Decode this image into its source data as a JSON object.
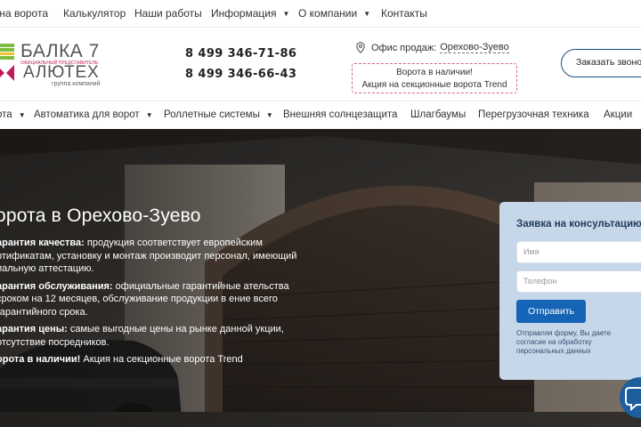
{
  "topnav": {
    "items": [
      {
        "label": " на ворота",
        "dropdown": false
      },
      {
        "label": "Калькулятор",
        "dropdown": false
      },
      {
        "label": "Наши работы",
        "dropdown": false
      },
      {
        "label": "Информация",
        "dropdown": true
      },
      {
        "label": "О компании",
        "dropdown": true
      },
      {
        "label": "Контакты",
        "dropdown": false
      }
    ]
  },
  "header": {
    "logo": {
      "line1": "БАЛКА 7",
      "small": "ОФИЦИАЛЬНЫЙ ПРЕДСТАВИТЕЛЬ",
      "line2": "АЛЮТЕХ",
      "group": "группа компаний",
      "colors": {
        "green": "#7bbd3c",
        "yellow": "#f2c12e",
        "magenta": "#c2185b"
      }
    },
    "phones": [
      "8 499 346-71-86",
      "8 499 346-66-43"
    ],
    "office": {
      "label": "Офис продаж:",
      "city": "Орехово-Зуево",
      "icon": "location-pin-icon"
    },
    "promo": {
      "line1": "Ворота в наличии!",
      "line2": "Акция на секционные ворота Trend"
    },
    "callback_label": "Заказать звонок"
  },
  "catnav": {
    "items": [
      {
        "label": "ота",
        "dropdown": true
      },
      {
        "label": "Автоматика для ворот",
        "dropdown": true
      },
      {
        "label": "Роллетные системы",
        "dropdown": true
      },
      {
        "label": "Внешняя солнцезащита",
        "dropdown": false
      },
      {
        "label": "Шлагбаумы",
        "dropdown": false
      },
      {
        "label": "Перегрузочная техника",
        "dropdown": false
      },
      {
        "label": "Акции",
        "dropdown": false
      }
    ]
  },
  "hero": {
    "title": "орота в Орехово-Зуево",
    "features": [
      {
        "bold": "арантия качества:",
        "text": " продукция соответствует европейским ртификатам, установку и монтаж производит персонал, имеющий иальную аттестацию."
      },
      {
        "bold": "арантия обслуживания:",
        "text": " официальные гарантийные ательства сроком на 12 месяцев, обслуживание продукции в ение всего гарантийного срока."
      },
      {
        "bold": "арантия цены:",
        "text": " самые выгодные цены на рынке данной укции, отсутствие посредников."
      },
      {
        "bold": "орота в наличии!",
        "text": " Акция на секционные ворота Trend"
      }
    ]
  },
  "form": {
    "title": "Заявка на консультацию",
    "name_placeholder": "Имя",
    "phone_placeholder": "Телефон",
    "submit_label": "Отправить",
    "consent": "Отправляя форму, Вы даете согласие на обработку персональных данных"
  },
  "colors": {
    "accent": "#1664b5",
    "form_bg": "#c7d7ea",
    "callback_border": "#1a4d7c",
    "chat": "#1d5f9e"
  }
}
